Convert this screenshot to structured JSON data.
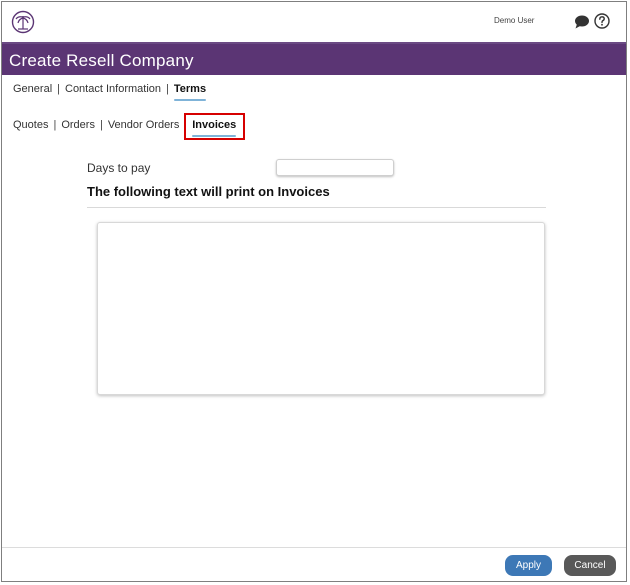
{
  "topbar": {
    "user": "Demo User"
  },
  "header": {
    "title": "Create Resell Company"
  },
  "main_tabs": [
    {
      "label": "General",
      "active": false
    },
    {
      "label": "Contact Information",
      "active": false
    },
    {
      "label": "Terms",
      "active": true
    }
  ],
  "sub_tabs": [
    {
      "label": "Quotes",
      "active": false
    },
    {
      "label": "Orders",
      "active": false
    },
    {
      "label": "Vendor Orders",
      "active": false
    },
    {
      "label": "Invoices",
      "active": true
    }
  ],
  "form": {
    "days_to_pay_label": "Days to pay",
    "days_to_pay_value": "",
    "section_title": "The following text will print on Invoices",
    "invoice_text": ""
  },
  "footer": {
    "apply_label": "Apply",
    "cancel_label": "Cancel"
  },
  "colors": {
    "header_bg": "#5b3574",
    "apply_bg": "#3d78b6",
    "cancel_bg": "#595959",
    "active_underline": "#7fb3d8",
    "highlight_border": "#d60000"
  },
  "icons": {
    "logo": "palm-logo-icon",
    "chat": "chat-bubble-icon",
    "help": "question-circle-icon"
  }
}
